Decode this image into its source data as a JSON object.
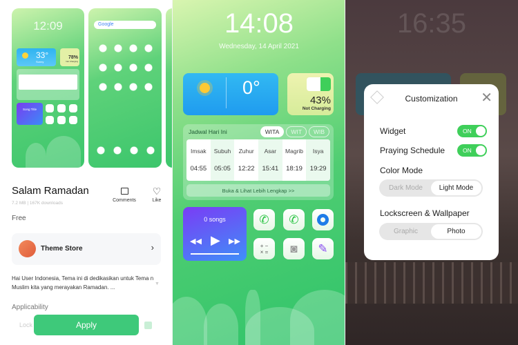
{
  "theme_detail": {
    "preview_lock": {
      "time": "12:09",
      "temp": "33°",
      "weather": "Sunny",
      "battery": "78%",
      "battery_status": "Not Charging",
      "song": "Song Title"
    },
    "preview_home": {
      "search": "Google"
    },
    "title": "Salam Ramadan",
    "meta": "7.2 MB | 167K downloads",
    "comments_label": "Comments",
    "like_label": "Like",
    "price": "Free",
    "store_name": "Theme Store",
    "description": "Hai User Indonesia, Tema ini di dedikasikan untuk Tema n Muslim kita yang merayakan Ramadan. ...",
    "applicability_label": "Applicability",
    "lock_label": "Lock",
    "apply_label": "Apply",
    "accent": "#3ec97a"
  },
  "lockscreen": {
    "time": "14:08",
    "date": "Wednesday, 14 April 2021",
    "weather_temp": "0°",
    "battery_percent": "43%",
    "battery_status": "Not Charging",
    "battery_level": 0.43,
    "schedule": {
      "title": "Jadwal Hari Ini",
      "zones": [
        "WITA",
        "WIT",
        "WIB"
      ],
      "selected_zone": "WITA",
      "prayers": [
        {
          "name": "Imsak",
          "time": "04:55"
        },
        {
          "name": "Subuh",
          "time": "05:05"
        },
        {
          "name": "Zuhur",
          "time": "12:22"
        },
        {
          "name": "Asar",
          "time": "15:41"
        },
        {
          "name": "Magrib",
          "time": "18:19"
        },
        {
          "name": "Isya",
          "time": "19:29"
        }
      ],
      "more_label": "Buka & Lihat Lebih Lengkap >>"
    },
    "music": {
      "songs": "0 songs"
    },
    "apps": [
      "whatsapp-icon",
      "phone-icon",
      "browser-icon",
      "calculator-icon",
      "camera-icon",
      "theme-brush-icon"
    ]
  },
  "customization": {
    "bg_time": "16:35",
    "title": "Customization",
    "widget_label": "Widget",
    "widget_state": "ON",
    "praying_label": "Praying Schedule",
    "praying_state": "ON",
    "color_mode_label": "Color Mode",
    "color_modes": [
      "Dark Mode",
      "Light Mode"
    ],
    "color_mode_selected": "Light Mode",
    "wallpaper_label": "Lockscreen & Wallpaper",
    "wallpaper_modes": [
      "Graphic",
      "Photo"
    ],
    "wallpaper_selected": "Photo",
    "toggle_color": "#3fcf5a"
  }
}
